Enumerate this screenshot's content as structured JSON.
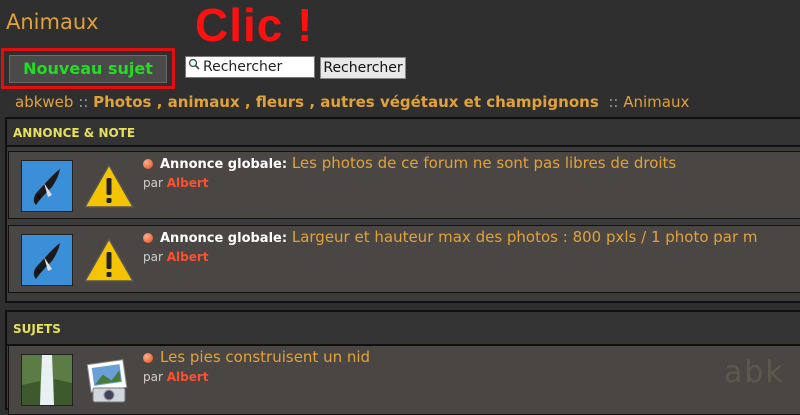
{
  "forum_title": "Animaux",
  "annotation_text": "Clic !",
  "new_topic_button": "Nouveau sujet",
  "search": {
    "value": "Rechercher",
    "button_label": "Rechercher"
  },
  "breadcrumb": {
    "home": "abkweb",
    "sep": "::",
    "category": "Photos , animaux , fleurs , autres végétaux et champignons",
    "current": "Animaux"
  },
  "announcements": {
    "header": "ANNONCE & NOTE",
    "rows": [
      {
        "label": "Annonce globale:",
        "title": "Les photos de ce forum ne sont pas libres de droits",
        "by": "par",
        "author": "Albert"
      },
      {
        "label": "Annonce globale:",
        "title": "Largeur et hauteur max des photos : 800 pxls / 1 photo par m",
        "by": "par",
        "author": "Albert"
      }
    ]
  },
  "topics": {
    "header": "SUJETS",
    "rows": [
      {
        "title": "Les pies construisent un nid",
        "by": "par",
        "author": "Albert"
      }
    ]
  },
  "watermark": "abk"
}
